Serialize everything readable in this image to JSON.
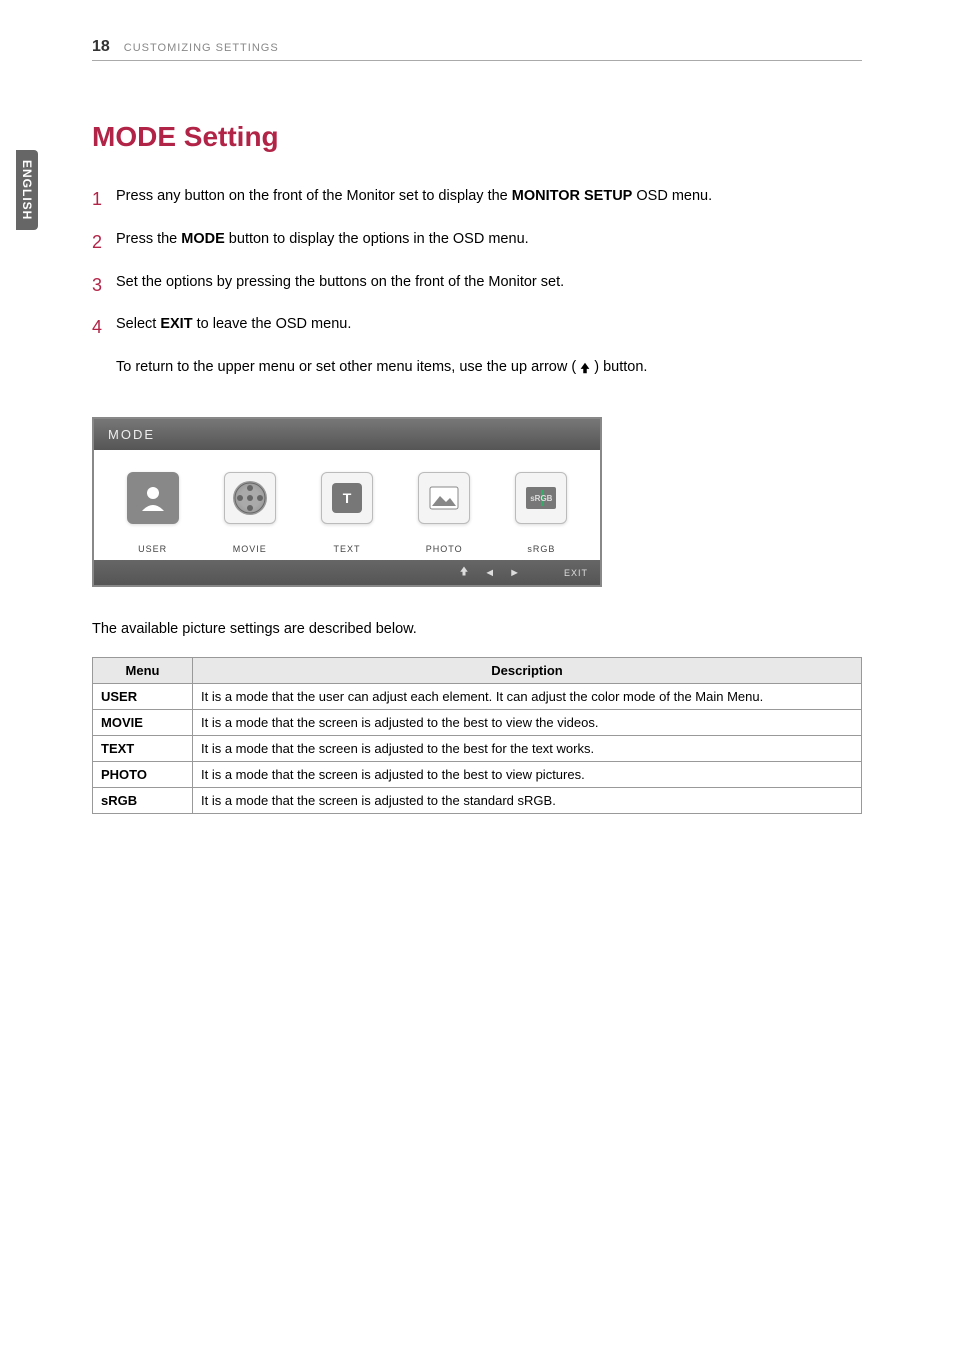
{
  "header": {
    "page_number": "18",
    "section": "CUSTOMIZING SETTINGS",
    "language_tab": "ENGLISH"
  },
  "heading": "MODE Setting",
  "steps": [
    {
      "n": "1",
      "pre": "Press any button on the front of the Monitor set to display the ",
      "bold": "MONITOR SETUP",
      "post": " OSD menu."
    },
    {
      "n": "2",
      "pre": "Press the ",
      "bold": "MODE",
      "post": " button to display the options in the OSD menu."
    },
    {
      "n": "3",
      "pre": "Set the options by pressing the buttons on the front of the Monitor set.",
      "bold": "",
      "post": ""
    },
    {
      "n": "4",
      "pre": "Select ",
      "bold": "EXIT",
      "post": " to leave the OSD menu."
    }
  ],
  "step4_subline_pre": "To return to the upper menu or set other menu items, use the up arrow (",
  "step4_subline_post": ") button.",
  "osd": {
    "title": "MODE",
    "items": [
      {
        "label": "USER",
        "icon": "user-icon",
        "selected": true
      },
      {
        "label": "MOVIE",
        "icon": "movie-icon",
        "selected": false
      },
      {
        "label": "TEXT",
        "icon": "text-icon",
        "selected": false
      },
      {
        "label": "PHOTO",
        "icon": "photo-icon",
        "selected": false
      },
      {
        "label": "sRGB",
        "icon": "srgb-icon",
        "selected": false
      }
    ],
    "exit": "EXIT"
  },
  "table_intro": "The available picture settings are described below.",
  "table": {
    "headers": {
      "menu": "Menu",
      "desc": "Description"
    },
    "rows": [
      {
        "menu": "USER",
        "desc": "It is a mode that the user can adjust each element. It can adjust the color mode of the Main Menu."
      },
      {
        "menu": "MOVIE",
        "desc": "It is a mode that the screen is adjusted to the best to view the videos."
      },
      {
        "menu": "TEXT",
        "desc": "It is a mode that the screen is adjusted to the best for the text works."
      },
      {
        "menu": "PHOTO",
        "desc": "It is a mode that the screen is adjusted to the best to view pictures."
      },
      {
        "menu": "sRGB",
        "desc": "It is a mode that the screen is adjusted to the standard sRGB."
      }
    ]
  }
}
